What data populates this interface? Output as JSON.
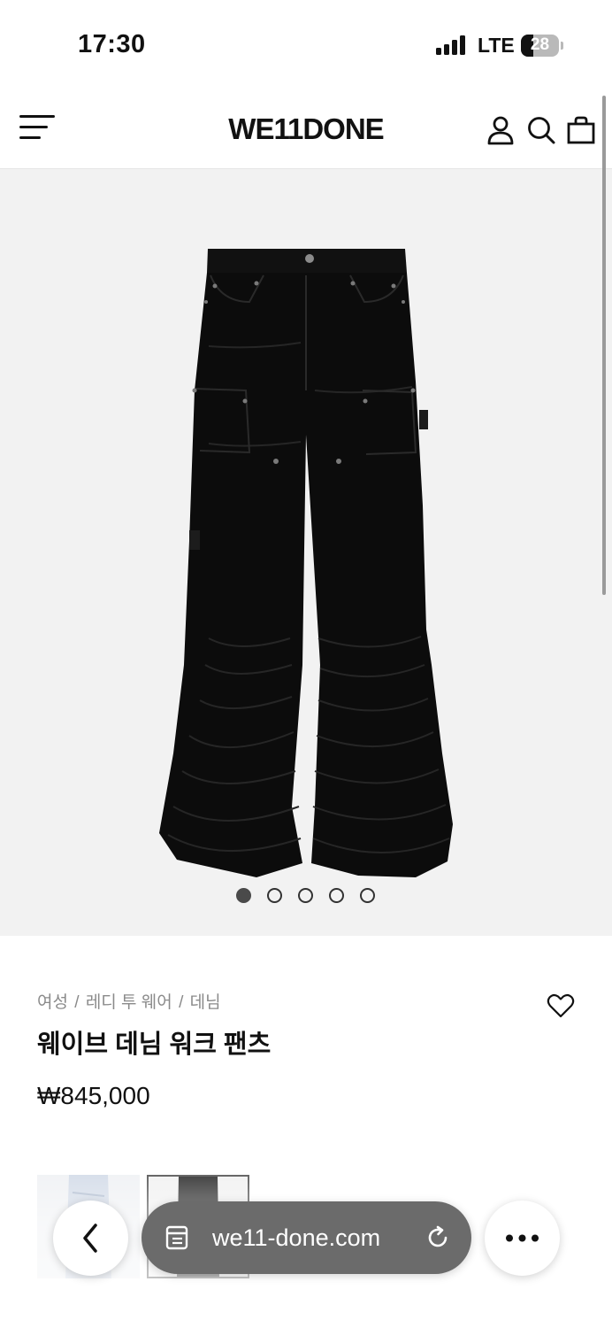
{
  "status_bar": {
    "time": "17:30",
    "network": "LTE",
    "battery": "28"
  },
  "header": {
    "logo": "WE11DONE",
    "icons": [
      "menu-icon",
      "user-icon",
      "search-icon",
      "bag-icon"
    ]
  },
  "gallery": {
    "image_count": 5,
    "active_index": 0
  },
  "product": {
    "breadcrumb": [
      "여성",
      "레디 투 웨어",
      "데님"
    ],
    "breadcrumb_separator": "/",
    "title": "웨이브 데님 워크 팬츠",
    "price": "₩845,000"
  },
  "browser": {
    "url": "we11-done.com",
    "icons": [
      "back-icon",
      "tabs-icon",
      "reload-icon",
      "more-icon"
    ]
  },
  "colors": {
    "hero_bg": "#f2f2f2",
    "text": "#111111",
    "muted": "#8a8a8a",
    "url_pill": "#6b6b6b"
  }
}
